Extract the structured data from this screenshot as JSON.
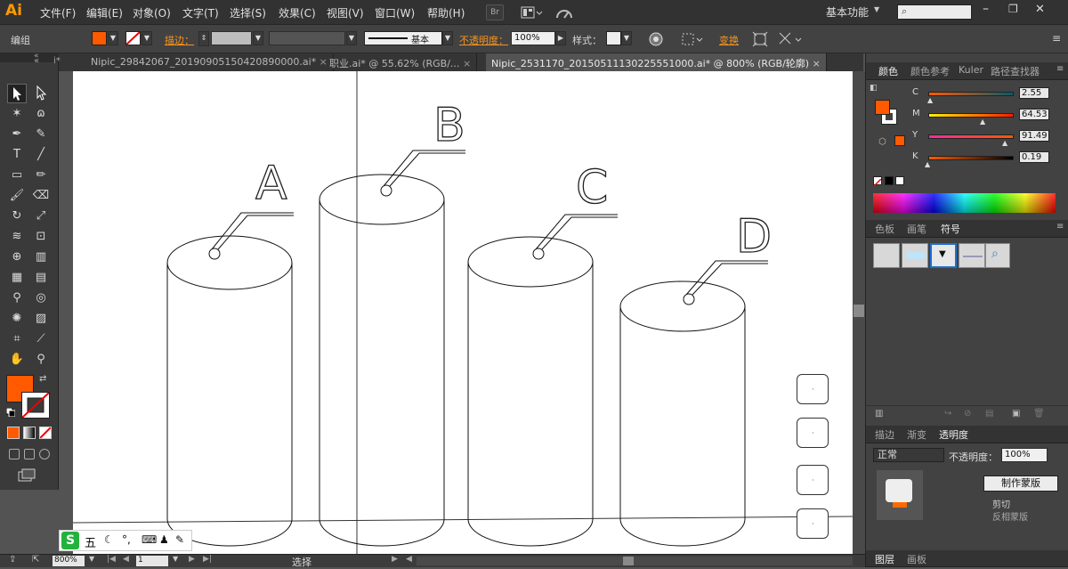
{
  "app": {
    "logo": "Ai"
  },
  "menu": [
    "文件(F)",
    "编辑(E)",
    "对象(O)",
    "文字(T)",
    "选择(S)",
    "效果(C)",
    "视图(V)",
    "窗口(W)",
    "帮助(H)"
  ],
  "menu_icons": {
    "bridge": "Br",
    "layout": "arrange-documents-icon",
    "gpu": "gpu-performance-icon"
  },
  "workspace": {
    "label": "基本功能",
    "search_placeholder": ""
  },
  "control": {
    "selection_label": "编组",
    "fill_color": "#ff5a00",
    "stroke_label": "描边：",
    "stroke_value": "",
    "line_style": "基本",
    "opacity_label": "不透明度：",
    "opacity_value": "100%",
    "style_label": "样式：",
    "transform_label": "变换"
  },
  "tabs": [
    {
      "label": "Nipic_29842067_20190905150420890000.ai*",
      "active": false
    },
    {
      "label": "职业.ai* @ 55.62% (RGB/...",
      "active": false
    },
    {
      "label": "Nipic_2531170_20150511130225551000.ai* @ 800% (RGB/轮廓)",
      "active": true
    }
  ],
  "canvas": {
    "labels": [
      "A",
      "B",
      "C",
      "D"
    ]
  },
  "status": {
    "zoom": "800%",
    "page": "1",
    "mode": "选择"
  },
  "color_panel": {
    "tabs": [
      "颜色",
      "颜色参考",
      "Kuler",
      "路径查找器"
    ],
    "channels": [
      {
        "name": "C",
        "value": "2.55",
        "level": 0.03
      },
      {
        "name": "M",
        "value": "64.53",
        "level": 0.65
      },
      {
        "name": "Y",
        "value": "91.49",
        "level": 0.91
      },
      {
        "name": "K",
        "value": "0.19",
        "level": 0.0
      }
    ],
    "fill": "#ff5a00"
  },
  "swatch_panel": {
    "tabs": [
      "色板",
      "画笔",
      "符号"
    ]
  },
  "transparency_panel": {
    "tabs": [
      "描边",
      "渐变",
      "透明度"
    ],
    "blend_mode": "正常",
    "opacity_label": "不透明度：",
    "opacity_value": "100%",
    "mask_button": "制作蒙版",
    "clip_label": "剪切",
    "invert_label": "反相蒙版"
  },
  "layers_panel": {
    "tabs": [
      "图层",
      "画板"
    ]
  },
  "ime": {
    "logo": "S",
    "label": "五"
  }
}
